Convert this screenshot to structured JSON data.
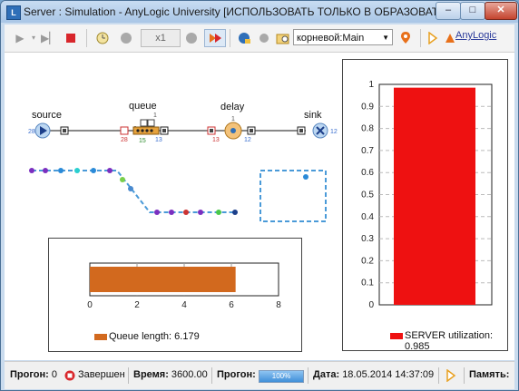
{
  "window": {
    "title": "Server : Simulation - AnyLogic University  [ИСПОЛЬЗОВАТЬ ТОЛЬКО В ОБРАЗОВАТЕЛЬН...",
    "icon_letter": "L",
    "minimize_glyph": "–",
    "maximize_glyph": "□",
    "close_glyph": "✕"
  },
  "toolbar": {
    "speed_value": "x1",
    "experiment_select": "корневой:Main",
    "anylogic_link": "AnyLogic"
  },
  "model": {
    "blocks": [
      {
        "name": "source",
        "in": "28",
        "out": ""
      },
      {
        "name": "queue",
        "in": "28",
        "out": "13",
        "count": "15",
        "capacity": "1"
      },
      {
        "name": "delay",
        "in": "13",
        "out": "12",
        "count": "1"
      },
      {
        "name": "sink",
        "in": "12",
        "out": ""
      }
    ]
  },
  "chart_data": [
    {
      "type": "bar",
      "orientation": "horizontal",
      "categories": [
        "Queue length"
      ],
      "values": [
        6.179
      ],
      "xlim": [
        0,
        8
      ],
      "xticks": [
        "0",
        "2",
        "4",
        "6",
        "8"
      ],
      "legend": "Queue length: 6.179",
      "color": "#d2691e"
    },
    {
      "type": "bar",
      "orientation": "vertical",
      "categories": [
        "SERVER utilization"
      ],
      "values": [
        0.985
      ],
      "ylim": [
        0,
        1
      ],
      "yticks": [
        "0",
        "0.1",
        "0.2",
        "0.3",
        "0.4",
        "0.5",
        "0.6",
        "0.7",
        "0.8",
        "0.9",
        "1"
      ],
      "legend": "SERVER utilization: 0.985",
      "color": "#ee1111"
    }
  ],
  "status": {
    "run_label": "Прогон:",
    "run_value": "0",
    "state": "Завершен",
    "time_label": "Время:",
    "time_value": "3600.00",
    "progress_label": "Прогон:",
    "progress_value": "100%",
    "date_label": "Дата:",
    "date_value": "18.05.2014 14:37:09",
    "memory_label": "Память:"
  },
  "colors": {
    "queue_bar": "#d2691e",
    "utilization_bar": "#ee1111",
    "path_dash": "#4a9ad8"
  }
}
